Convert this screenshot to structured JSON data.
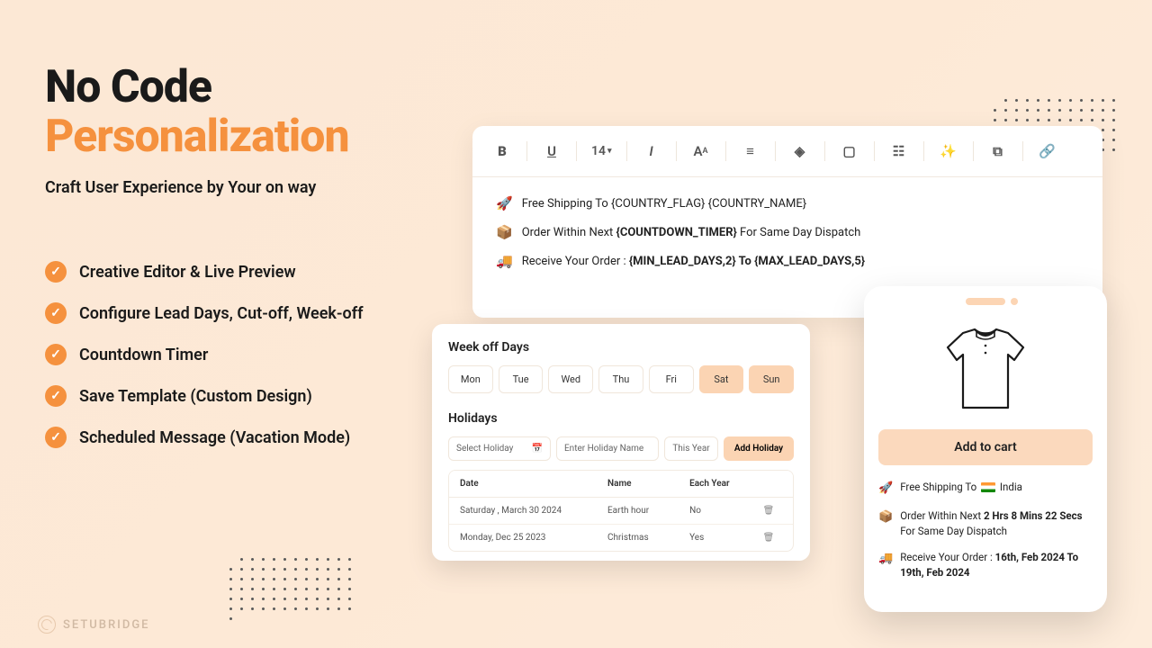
{
  "hero": {
    "title_line1": "No Code",
    "title_line2": "Personalization",
    "subtitle": "Craft User Experience by Your on way"
  },
  "features": [
    "Creative Editor & Live Preview",
    "Configure Lead Days, Cut-off, Week-off",
    "Countdown Timer",
    "Save Template (Custom Design)",
    "Scheduled Message (Vacation Mode)"
  ],
  "toolbar": {
    "font_size": "14"
  },
  "editor_lines": {
    "line1": "Free Shipping To {COUNTRY_FLAG} {COUNTRY_NAME}",
    "line2_a": "Order Within Next ",
    "line2_b": "{COUNTDOWN_TIMER}",
    "line2_c": " For Same Day Dispatch",
    "line3_a": "Receive Your Order :  ",
    "line3_b": "{MIN_LEAD_DAYS,2} To  {MAX_LEAD_DAYS,5}"
  },
  "weekoff": {
    "title": "Week off Days",
    "days": [
      "Mon",
      "Tue",
      "Wed",
      "Thu",
      "Fri",
      "Sat",
      "Sun"
    ],
    "on": [
      "Sat",
      "Sun"
    ]
  },
  "holidays": {
    "title": "Holidays",
    "select_ph": "Select Holiday",
    "name_ph": "Enter Holiday Name",
    "this_year": "This Year",
    "add_btn": "Add Holiday",
    "cols": {
      "date": "Date",
      "name": "Name",
      "each": "Each Year"
    },
    "rows": [
      {
        "date": "Saturday , March 30 2024",
        "name": "Earth hour",
        "each": "No"
      },
      {
        "date": "Monday, Dec  25  2023",
        "name": "Christmas",
        "each": "Yes"
      }
    ]
  },
  "phone": {
    "atc": "Add to cart",
    "l1_a": "Free Shipping To ",
    "l1_b": " India",
    "l2_a": "Order Within Next ",
    "l2_b": "2 Hrs 8 Mins 22 Secs",
    "l2_c": " For Same Day Dispatch",
    "l3_a": "Receive Your Order :  ",
    "l3_b": "16th, Feb 2024 To 19th, Feb 2024"
  },
  "brand": "SETUBRIDGE"
}
